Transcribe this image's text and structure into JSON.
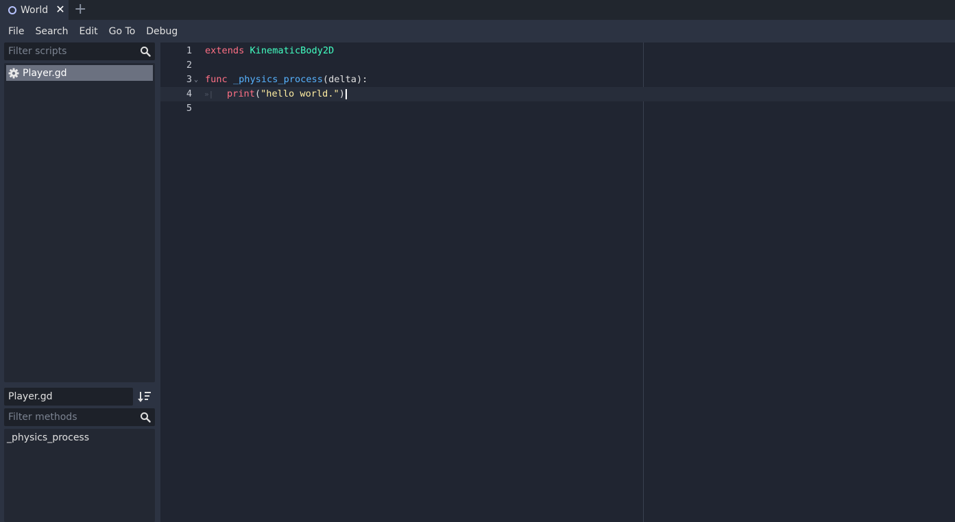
{
  "tabs": [
    {
      "label": "World",
      "close_label": "✕"
    }
  ],
  "tab_add_label": "+",
  "menu": [
    "File",
    "Search",
    "Edit",
    "Go To",
    "Debug"
  ],
  "scripts_panel": {
    "filter_placeholder": "Filter scripts",
    "items": [
      {
        "name": "Player.gd",
        "icon": "gear-icon",
        "selected": true
      }
    ]
  },
  "methods_panel": {
    "current_script": "Player.gd",
    "filter_placeholder": "Filter methods",
    "methods": [
      "_physics_process"
    ]
  },
  "editor": {
    "current_line": 4,
    "lines": [
      {
        "num": "1",
        "tokens": [
          {
            "t": "extends",
            "c": "kw"
          },
          {
            "t": " ",
            "c": ""
          },
          {
            "t": "KinematicBody2D",
            "c": "cls"
          }
        ]
      },
      {
        "num": "2",
        "tokens": []
      },
      {
        "num": "3",
        "fold": true,
        "tokens": [
          {
            "t": "func",
            "c": "kw"
          },
          {
            "t": " ",
            "c": ""
          },
          {
            "t": "_physics_process",
            "c": "fn"
          },
          {
            "t": "(delta):",
            "c": "paren"
          }
        ]
      },
      {
        "num": "4",
        "indent": true,
        "tokens": [
          {
            "t": "print",
            "c": "fn2"
          },
          {
            "t": "(",
            "c": "paren"
          },
          {
            "t": "\"hello world.\"",
            "c": "str"
          },
          {
            "t": ")",
            "c": "paren"
          }
        ]
      },
      {
        "num": "5",
        "tokens": []
      }
    ]
  },
  "colors": {
    "keyword": "#ff7085",
    "class": "#42ffc2",
    "function": "#57b3ff",
    "string": "#ffeda1",
    "accent": "#b8c4ff"
  }
}
